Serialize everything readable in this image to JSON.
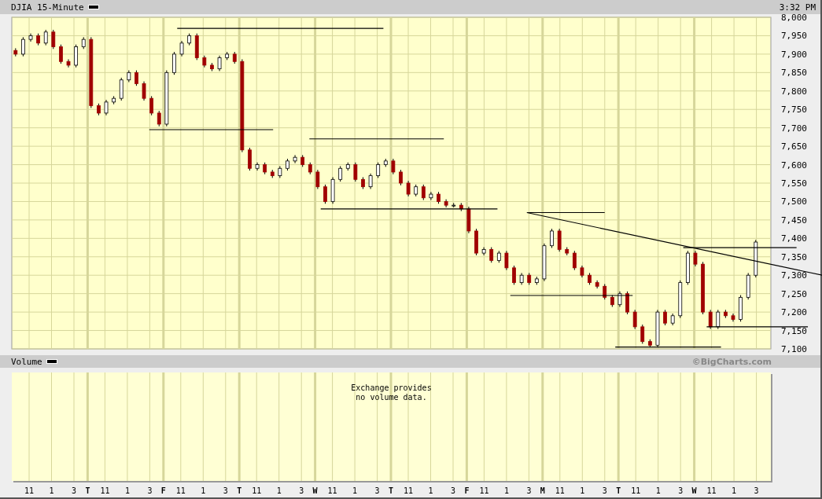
{
  "window": {
    "title": "DJIA 15-Minute",
    "time": "3:32 PM"
  },
  "price_panel": {
    "chart_data": {
      "type": "candlestick",
      "grid": true,
      "ylim": [
        7100,
        8000
      ],
      "categories": [
        null,
        null,
        null,
        null,
        null,
        null,
        null,
        null,
        null,
        null,
        null,
        null,
        null,
        null,
        null,
        null,
        null,
        null,
        null,
        null,
        null,
        null,
        null,
        null,
        null,
        null,
        null,
        null,
        null,
        null,
        null,
        null,
        null,
        null,
        null,
        null,
        null,
        null,
        null,
        null,
        null,
        null,
        null,
        null,
        null,
        null,
        null,
        null,
        null,
        null,
        null,
        null,
        null,
        null,
        null,
        null,
        null,
        null,
        null,
        null,
        null,
        null,
        null,
        null,
        null,
        null,
        null,
        null,
        null,
        null,
        null,
        null,
        null,
        null,
        null,
        null,
        null,
        null,
        null,
        null,
        null,
        null,
        null,
        null,
        null,
        null,
        null,
        null,
        null,
        null,
        null,
        null,
        null,
        null,
        null,
        null,
        null,
        null,
        null
      ],
      "ohlc": [
        [
          7910,
          7916,
          7894,
          7900
        ],
        [
          7900,
          7946,
          7894,
          7940
        ],
        [
          7940,
          7956,
          7934,
          7950
        ],
        [
          7950,
          7956,
          7924,
          7930
        ],
        [
          7930,
          7966,
          7924,
          7960
        ],
        [
          7960,
          7966,
          7914,
          7920
        ],
        [
          7920,
          7926,
          7874,
          7880
        ],
        [
          7880,
          7886,
          7864,
          7870
        ],
        [
          7870,
          7926,
          7864,
          7920
        ],
        [
          7920,
          7946,
          7914,
          7940
        ],
        [
          7940,
          7946,
          7754,
          7760
        ],
        [
          7760,
          7766,
          7734,
          7740
        ],
        [
          7740,
          7776,
          7734,
          7770
        ],
        [
          7770,
          7786,
          7764,
          7780
        ],
        [
          7780,
          7836,
          7774,
          7830
        ],
        [
          7830,
          7856,
          7824,
          7850
        ],
        [
          7850,
          7856,
          7814,
          7820
        ],
        [
          7820,
          7826,
          7774,
          7780
        ],
        [
          7780,
          7786,
          7734,
          7740
        ],
        [
          7740,
          7746,
          7704,
          7710
        ],
        [
          7710,
          7856,
          7704,
          7850
        ],
        [
          7850,
          7906,
          7844,
          7900
        ],
        [
          7900,
          7936,
          7894,
          7930
        ],
        [
          7930,
          7956,
          7924,
          7950
        ],
        [
          7950,
          7956,
          7884,
          7890
        ],
        [
          7890,
          7896,
          7864,
          7870
        ],
        [
          7870,
          7876,
          7854,
          7860
        ],
        [
          7860,
          7896,
          7854,
          7890
        ],
        [
          7890,
          7906,
          7884,
          7900
        ],
        [
          7900,
          7906,
          7874,
          7880
        ],
        [
          7880,
          7886,
          7634,
          7640
        ],
        [
          7640,
          7646,
          7584,
          7590
        ],
        [
          7590,
          7606,
          7584,
          7600
        ],
        [
          7600,
          7606,
          7574,
          7580
        ],
        [
          7580,
          7586,
          7564,
          7570
        ],
        [
          7570,
          7596,
          7564,
          7590
        ],
        [
          7590,
          7616,
          7584,
          7610
        ],
        [
          7610,
          7626,
          7604,
          7620
        ],
        [
          7620,
          7626,
          7594,
          7600
        ],
        [
          7600,
          7606,
          7574,
          7580
        ],
        [
          7580,
          7586,
          7534,
          7540
        ],
        [
          7540,
          7546,
          7494,
          7500
        ],
        [
          7500,
          7566,
          7494,
          7560
        ],
        [
          7560,
          7596,
          7554,
          7590
        ],
        [
          7590,
          7606,
          7584,
          7600
        ],
        [
          7600,
          7606,
          7554,
          7560
        ],
        [
          7560,
          7566,
          7534,
          7540
        ],
        [
          7540,
          7576,
          7534,
          7570
        ],
        [
          7570,
          7606,
          7564,
          7600
        ],
        [
          7600,
          7616,
          7594,
          7610
        ],
        [
          7610,
          7616,
          7574,
          7580
        ],
        [
          7580,
          7586,
          7544,
          7550
        ],
        [
          7550,
          7556,
          7514,
          7520
        ],
        [
          7520,
          7546,
          7514,
          7540
        ],
        [
          7540,
          7546,
          7504,
          7510
        ],
        [
          7510,
          7526,
          7504,
          7520
        ],
        [
          7520,
          7526,
          7494,
          7500
        ],
        [
          7500,
          7506,
          7484,
          7490
        ],
        [
          7490,
          7496,
          7484,
          7490
        ],
        [
          7490,
          7496,
          7474,
          7480
        ],
        [
          7480,
          7486,
          7414,
          7420
        ],
        [
          7420,
          7426,
          7354,
          7360
        ],
        [
          7360,
          7376,
          7354,
          7370
        ],
        [
          7370,
          7376,
          7334,
          7340
        ],
        [
          7340,
          7366,
          7334,
          7360
        ],
        [
          7360,
          7366,
          7314,
          7320
        ],
        [
          7320,
          7326,
          7274,
          7280
        ],
        [
          7280,
          7306,
          7274,
          7300
        ],
        [
          7300,
          7306,
          7274,
          7280
        ],
        [
          7280,
          7296,
          7274,
          7290
        ],
        [
          7290,
          7386,
          7284,
          7380
        ],
        [
          7380,
          7426,
          7374,
          7420
        ],
        [
          7420,
          7426,
          7364,
          7370
        ],
        [
          7370,
          7376,
          7354,
          7360
        ],
        [
          7360,
          7366,
          7314,
          7320
        ],
        [
          7320,
          7326,
          7294,
          7300
        ],
        [
          7300,
          7306,
          7274,
          7280
        ],
        [
          7280,
          7286,
          7264,
          7270
        ],
        [
          7270,
          7276,
          7234,
          7240
        ],
        [
          7240,
          7246,
          7214,
          7220
        ],
        [
          7220,
          7256,
          7214,
          7250
        ],
        [
          7250,
          7256,
          7194,
          7200
        ],
        [
          7200,
          7206,
          7154,
          7160
        ],
        [
          7160,
          7166,
          7114,
          7120
        ],
        [
          7120,
          7126,
          7104,
          7110
        ],
        [
          7110,
          7206,
          7104,
          7200
        ],
        [
          7200,
          7206,
          7164,
          7170
        ],
        [
          7170,
          7196,
          7164,
          7190
        ],
        [
          7190,
          7286,
          7184,
          7280
        ],
        [
          7280,
          7366,
          7274,
          7360
        ],
        [
          7360,
          7366,
          7324,
          7330
        ],
        [
          7330,
          7336,
          7194,
          7200
        ],
        [
          7200,
          7206,
          7154,
          7160
        ],
        [
          7160,
          7206,
          7154,
          7200
        ],
        [
          7200,
          7206,
          7184,
          7190
        ],
        [
          7190,
          7196,
          7174,
          7180
        ],
        [
          7180,
          7246,
          7174,
          7240
        ],
        [
          7240,
          7306,
          7234,
          7300
        ],
        [
          7300,
          7396,
          7294,
          7390
        ]
      ],
      "yticks": [
        {
          "value": 8000,
          "label": "8,000"
        },
        {
          "value": 7950,
          "label": "7,950"
        },
        {
          "value": 7900,
          "label": "7,900"
        },
        {
          "value": 7850,
          "label": "7,850"
        },
        {
          "value": 7800,
          "label": "7,800"
        },
        {
          "value": 7750,
          "label": "7,750"
        },
        {
          "value": 7700,
          "label": "7,700"
        },
        {
          "value": 7650,
          "label": "7,650"
        },
        {
          "value": 7600,
          "label": "7,600"
        },
        {
          "value": 7550,
          "label": "7,550"
        },
        {
          "value": 7500,
          "label": "7,500"
        },
        {
          "value": 7450,
          "label": "7,450"
        },
        {
          "value": 7400,
          "label": "7,400"
        },
        {
          "value": 7350,
          "label": "7,350"
        },
        {
          "value": 7300,
          "label": "7,300"
        },
        {
          "value": 7250,
          "label": "7,250"
        },
        {
          "value": 7200,
          "label": "7,200"
        },
        {
          "value": 7150,
          "label": "7,150"
        },
        {
          "value": 7100,
          "label": "7,100"
        }
      ]
    },
    "time_axis": [
      {
        "label": "11",
        "kind": "hour"
      },
      {
        "label": "1",
        "kind": "hour"
      },
      {
        "label": "3",
        "kind": "hour"
      },
      {
        "label": "T",
        "kind": "day"
      },
      {
        "label": "11",
        "kind": "hour"
      },
      {
        "label": "1",
        "kind": "hour"
      },
      {
        "label": "3",
        "kind": "hour"
      },
      {
        "label": "F",
        "kind": "day"
      },
      {
        "label": "11",
        "kind": "hour"
      },
      {
        "label": "1",
        "kind": "hour"
      },
      {
        "label": "3",
        "kind": "hour"
      },
      {
        "label": "T",
        "kind": "day"
      },
      {
        "label": "11",
        "kind": "hour"
      },
      {
        "label": "1",
        "kind": "hour"
      },
      {
        "label": "3",
        "kind": "hour"
      },
      {
        "label": "W",
        "kind": "day"
      },
      {
        "label": "11",
        "kind": "hour"
      },
      {
        "label": "1",
        "kind": "hour"
      },
      {
        "label": "3",
        "kind": "hour"
      },
      {
        "label": "T",
        "kind": "day"
      },
      {
        "label": "11",
        "kind": "hour"
      },
      {
        "label": "1",
        "kind": "hour"
      },
      {
        "label": "3",
        "kind": "hour"
      },
      {
        "label": "F",
        "kind": "day"
      },
      {
        "label": "11",
        "kind": "hour"
      },
      {
        "label": "1",
        "kind": "hour"
      },
      {
        "label": "3",
        "kind": "hour"
      },
      {
        "label": "M",
        "kind": "day"
      },
      {
        "label": "11",
        "kind": "hour"
      },
      {
        "label": "1",
        "kind": "hour"
      },
      {
        "label": "3",
        "kind": "hour"
      },
      {
        "label": "T",
        "kind": "day"
      },
      {
        "label": "11",
        "kind": "hour"
      },
      {
        "label": "1",
        "kind": "hour"
      },
      {
        "label": "3",
        "kind": "hour"
      },
      {
        "label": "W",
        "kind": "day"
      },
      {
        "label": "11",
        "kind": "hour"
      },
      {
        "label": "1",
        "kind": "hour"
      },
      {
        "label": "3",
        "kind": "hour"
      }
    ]
  },
  "volume_panel": {
    "title": "Volume",
    "credit": "©BigCharts.com",
    "message": "Exchange provides no volume data."
  }
}
